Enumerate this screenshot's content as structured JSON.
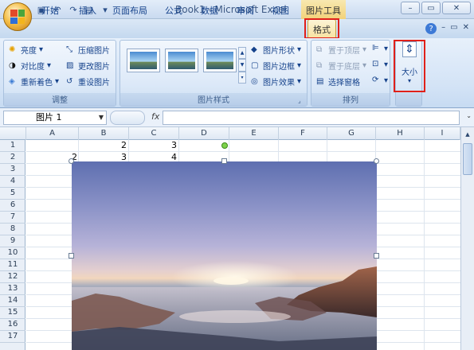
{
  "title_bar": {
    "title": "Book1 - Microsoft Excel",
    "context_tools": "图片工具"
  },
  "tabs": [
    {
      "label": "开始"
    },
    {
      "label": "插入"
    },
    {
      "label": "页面布局"
    },
    {
      "label": "公式"
    },
    {
      "label": "数据"
    },
    {
      "label": "审阅"
    },
    {
      "label": "视图"
    }
  ],
  "active_tab": "格式",
  "ribbon": {
    "adjust": {
      "label": "调整",
      "brightness": "亮度",
      "contrast": "对比度",
      "recolor": "重新着色",
      "compress": "压缩图片",
      "change": "更改图片",
      "reset": "重设图片"
    },
    "styles": {
      "label": "图片样式",
      "shape": "图片形状",
      "border": "图片边框",
      "effects": "图片效果"
    },
    "arrange": {
      "label": "排列",
      "bring_front": "置于顶层",
      "send_back": "置于底层",
      "selection_pane": "选择窗格"
    },
    "size": {
      "label": "大小"
    }
  },
  "formula_bar": {
    "name_box": "图片 1",
    "fx": "fx",
    "value": ""
  },
  "columns": [
    "A",
    "B",
    "C",
    "D",
    "E",
    "F",
    "G",
    "H",
    "I"
  ],
  "rows": [
    "1",
    "2",
    "3",
    "4",
    "5",
    "6",
    "7",
    "8",
    "9",
    "10",
    "11",
    "12",
    "13",
    "14",
    "15",
    "16",
    "17"
  ],
  "cells": {
    "B1": "2",
    "C1": "3",
    "A2": "2",
    "B2": "3",
    "C2": "4"
  },
  "colors": {
    "highlight": "#e0201a",
    "context_tab": "#f2d27a"
  }
}
